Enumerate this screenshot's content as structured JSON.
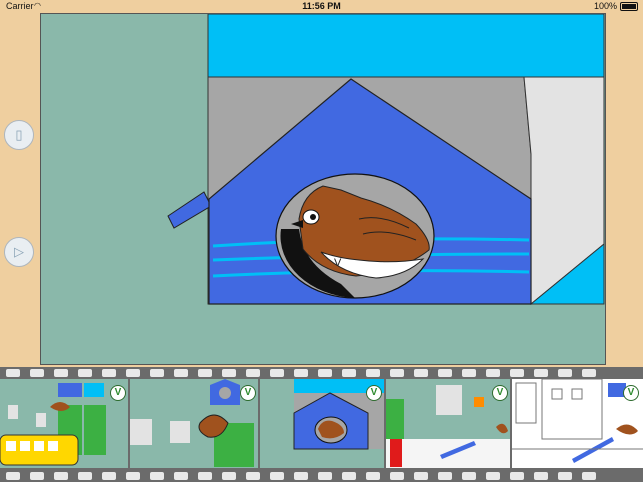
{
  "status_bar": {
    "carrier": "Carrier",
    "wifi_icon": "wifi-icon",
    "time": "11:56 PM",
    "battery": "100%"
  },
  "sidebar": {
    "buttons": [
      {
        "name": "page-button",
        "icon": "page-icon"
      },
      {
        "name": "play-button",
        "icon": "play-icon"
      }
    ]
  },
  "canvas": {
    "scene": "birdhouse",
    "bird_belly_mark": "V"
  },
  "filmstrip": {
    "frames": [
      {
        "scene": "bird-street",
        "checked": true
      },
      {
        "scene": "birdhouse-small",
        "checked": true
      },
      {
        "scene": "birdhouse-close",
        "checked": true
      },
      {
        "scene": "seesaw-color",
        "checked": true
      },
      {
        "scene": "seesaw-sketch",
        "checked": true
      }
    ],
    "check_mark": "V"
  },
  "colors": {
    "sky_blue": "#00bff6",
    "house_blue": "#4169e1",
    "teal_bg": "#8ab8aa",
    "bird_brown": "#a0521e",
    "wood_frame": "#efcf9f"
  }
}
